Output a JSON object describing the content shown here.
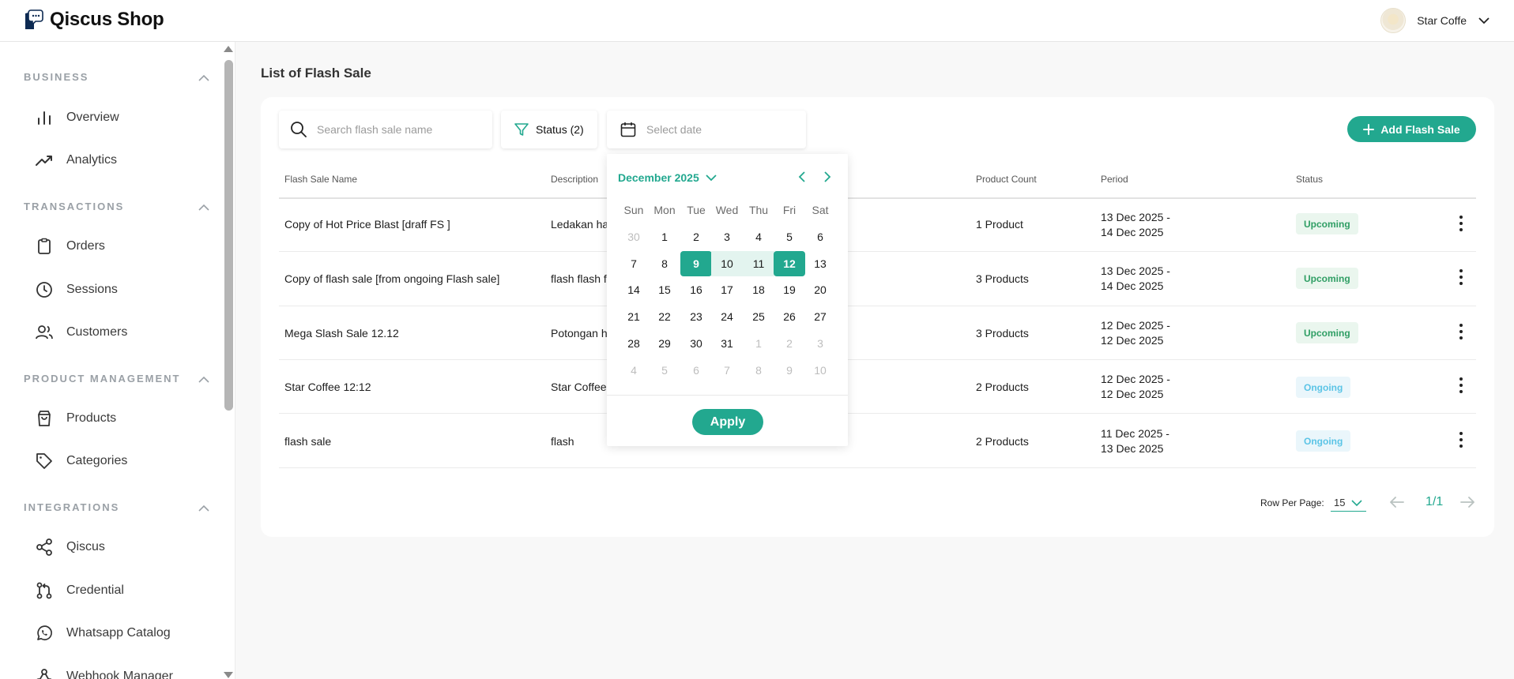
{
  "brand": {
    "name": "Qiscus Shop"
  },
  "user": {
    "name": "Star Coffe"
  },
  "sidebar": {
    "sections": [
      {
        "title": "BUSINESS",
        "items": [
          {
            "label": "Overview",
            "icon": "bar-chart-icon"
          },
          {
            "label": "Analytics",
            "icon": "trend-up-icon"
          }
        ]
      },
      {
        "title": "TRANSACTIONS",
        "items": [
          {
            "label": "Orders",
            "icon": "clipboard-icon"
          },
          {
            "label": "Sessions",
            "icon": "clock-icon"
          },
          {
            "label": "Customers",
            "icon": "users-icon"
          }
        ]
      },
      {
        "title": "PRODUCT MANAGEMENT",
        "items": [
          {
            "label": "Products",
            "icon": "shopping-bag-icon"
          },
          {
            "label": "Categories",
            "icon": "tag-icon"
          }
        ]
      },
      {
        "title": "INTEGRATIONS",
        "items": [
          {
            "label": "Qiscus",
            "icon": "share-icon"
          },
          {
            "label": "Credential",
            "icon": "git-pull-request-icon"
          },
          {
            "label": "Whatsapp Catalog",
            "icon": "whatsapp-icon"
          },
          {
            "label": "Webhook Manager",
            "icon": "webhook-icon"
          }
        ]
      }
    ]
  },
  "page": {
    "title": "List of Flash Sale"
  },
  "toolbar": {
    "search_placeholder": "Search flash sale name",
    "status_label": "Status (2)",
    "date_placeholder": "Select date",
    "add_label": "Add Flash Sale"
  },
  "table": {
    "columns": {
      "name": "Flash Sale Name",
      "description": "Description",
      "product_count": "Product Count",
      "period": "Period",
      "status": "Status"
    },
    "rows": [
      {
        "name": "Copy of Hot Price Blast [draff FS ]",
        "description": "Ledakan ha",
        "product_count": "1 Product",
        "period_start": "13 Dec 2025 -",
        "period_end": "14 Dec 2025",
        "status": "Upcoming"
      },
      {
        "name": "Copy of flash sale [from ongoing Flash sale]",
        "description": "flash flash f",
        "product_count": "3 Products",
        "period_start": "13 Dec 2025 -",
        "period_end": "14 Dec 2025",
        "status": "Upcoming"
      },
      {
        "name": "Mega Slash Sale 12.12",
        "description": "Potongan h",
        "product_count": "3 Products",
        "period_start": "12 Dec 2025 -",
        "period_end": "12 Dec 2025",
        "status": "Upcoming"
      },
      {
        "name": "Star Coffee 12:12",
        "description": "Star Coffee",
        "product_count": "2 Products",
        "period_start": "12 Dec 2025 -",
        "period_end": "12 Dec 2025",
        "status": "Ongoing"
      },
      {
        "name": "flash sale",
        "description": "flash",
        "product_count": "2 Products",
        "period_start": "11 Dec 2025 -",
        "period_end": "13 Dec 2025",
        "status": "Ongoing"
      }
    ]
  },
  "pagination": {
    "rows_label": "Row Per Page:",
    "rows_value": "15",
    "page": "1/1"
  },
  "calendar": {
    "month_label": "December 2025",
    "weekdays": [
      "Sun",
      "Mon",
      "Tue",
      "Wed",
      "Thu",
      "Fri",
      "Sat"
    ],
    "weeks": [
      [
        "30",
        "1",
        "2",
        "3",
        "4",
        "5",
        "6"
      ],
      [
        "7",
        "8",
        "9",
        "10",
        "11",
        "12",
        "13"
      ],
      [
        "14",
        "15",
        "16",
        "17",
        "18",
        "19",
        "20"
      ],
      [
        "21",
        "22",
        "23",
        "24",
        "25",
        "26",
        "27"
      ],
      [
        "28",
        "29",
        "30",
        "31",
        "1",
        "2",
        "3"
      ],
      [
        "4",
        "5",
        "6",
        "7",
        "8",
        "9",
        "10"
      ]
    ],
    "selected_start": "9",
    "selected_end": "12",
    "apply_label": "Apply"
  },
  "colors": {
    "accent": "#22a88f",
    "upcoming_text": "#2f9e64",
    "ongoing_text": "#5bc4e6"
  }
}
